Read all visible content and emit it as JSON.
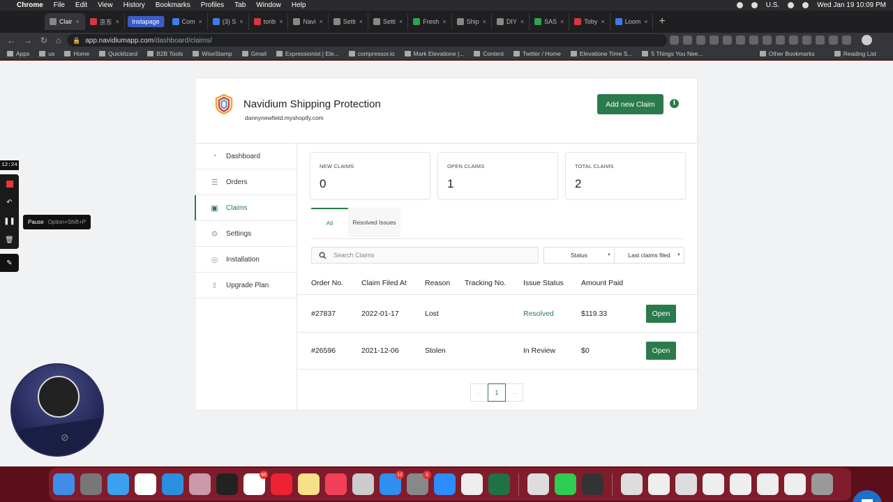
{
  "menubar": {
    "app": "Chrome",
    "items": [
      "File",
      "Edit",
      "View",
      "History",
      "Bookmarks",
      "Profiles",
      "Tab",
      "Window",
      "Help"
    ],
    "locale": "U.S.",
    "datetime": "Wed Jan 19  10:09 PM"
  },
  "tabs": [
    {
      "label": "Clair",
      "active": true
    },
    {
      "label": "京东",
      "active": false
    },
    {
      "label": "Instapage",
      "active": false
    },
    {
      "label": "Com",
      "active": false
    },
    {
      "label": "(3) S",
      "active": false
    },
    {
      "label": "torib",
      "active": false
    },
    {
      "label": "Navi",
      "active": false
    },
    {
      "label": "Setti",
      "active": false
    },
    {
      "label": "Setti",
      "active": false
    },
    {
      "label": "Fresh",
      "active": false
    },
    {
      "label": "Ship",
      "active": false
    },
    {
      "label": "DIY",
      "active": false
    },
    {
      "label": "SAS",
      "active": false
    },
    {
      "label": "Toby",
      "active": false
    },
    {
      "label": "Loom",
      "active": false
    }
  ],
  "address": {
    "host": "app.navidiumapp.com",
    "path": "/dashboard/claims/"
  },
  "bookmarks": [
    "Apps",
    "us",
    "Home",
    "Quicklizard",
    "B2B Tools",
    "WiseStamp",
    "Gmail",
    "Expressionist | Ele...",
    "compressor.io",
    "Mark Elevatione |...",
    "Content",
    "Twitter / Home",
    "Elevatione Time S...",
    "5 Things You Nee..."
  ],
  "bookmarks_right": [
    "Other Bookmarks",
    "Reading List"
  ],
  "app": {
    "title": "Navidium Shipping Protection",
    "store": "dannynewfield.myshopify.com",
    "add_claim_label": "Add new Claim",
    "info_label": "i",
    "brand_color": "#2b7a4b"
  },
  "sidebar": {
    "items": [
      {
        "label": "Dashboard",
        "icon": "dashboard-icon",
        "glyph": "◔",
        "active": false
      },
      {
        "label": "Orders",
        "icon": "list-icon",
        "glyph": "☰",
        "active": false
      },
      {
        "label": "Claims",
        "icon": "claims-icon",
        "glyph": "▣",
        "active": true
      },
      {
        "label": "Settings",
        "icon": "gear-icon",
        "glyph": "⚙",
        "active": false
      },
      {
        "label": "Installation",
        "icon": "install-icon",
        "glyph": "◎",
        "active": false
      },
      {
        "label": "Upgrade Plan",
        "icon": "upgrade-icon",
        "glyph": "⇪",
        "active": false
      }
    ]
  },
  "stats": [
    {
      "label": "NEW CLAIMS",
      "value": "0"
    },
    {
      "label": "OPEN CLAIMS",
      "value": "1"
    },
    {
      "label": "TOTAL CLAIMS",
      "value": "2"
    }
  ],
  "claim_tabs": [
    "All",
    "Resolved Issues"
  ],
  "filters": {
    "search_placeholder": "Search Claims",
    "status_label": "Status",
    "sort_label": "Last claims filed"
  },
  "table": {
    "columns": [
      "Order No.",
      "Claim Filed At",
      "Reason",
      "Tracking No.",
      "Issue Status",
      "Amount Paid"
    ],
    "rows": [
      {
        "order": "#27837",
        "filed": "2022-01-17",
        "reason": "Lost",
        "tracking": "",
        "status": "Resolved",
        "amount": "$119.33",
        "action": "Open"
      },
      {
        "order": "#26596",
        "filed": "2021-12-06",
        "reason": "Stolen",
        "tracking": "",
        "status": "In Review",
        "amount": "$0",
        "action": "Open"
      }
    ]
  },
  "pagination": {
    "prev": "←",
    "current": "1",
    "next": "→"
  },
  "recorder": {
    "timer": "12:24",
    "tooltip": "Pause",
    "tooltip_shortcut": "Option+Shift+P"
  },
  "dock_badges": {
    "slack": "66",
    "appstore": "12",
    "settings": "3"
  }
}
